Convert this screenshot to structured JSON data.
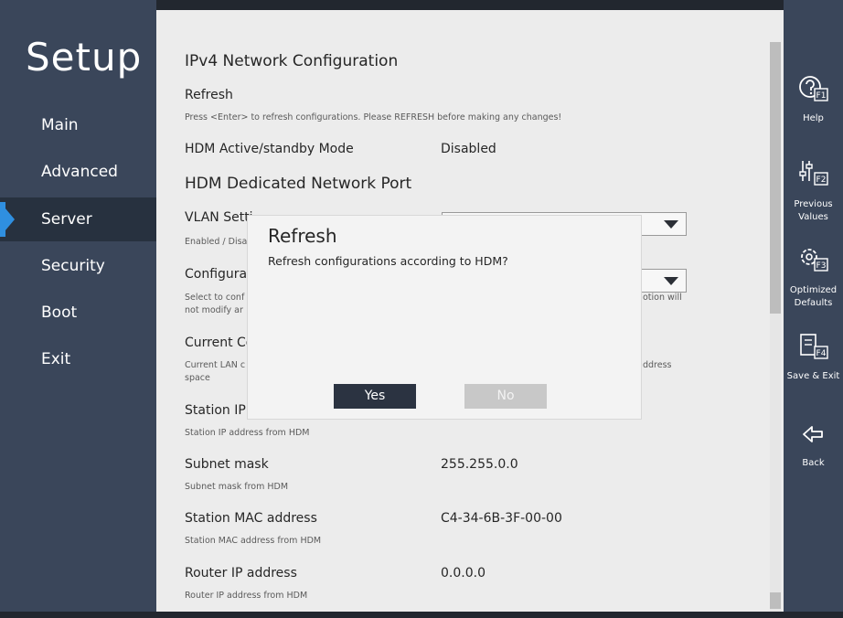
{
  "app": {
    "title": "Setup"
  },
  "nav": {
    "items": [
      {
        "label": "Main"
      },
      {
        "label": "Advanced"
      },
      {
        "label": "Server",
        "active": true
      },
      {
        "label": "Security"
      },
      {
        "label": "Boot"
      },
      {
        "label": "Exit"
      }
    ]
  },
  "content": {
    "section_title": "IPv4 Network Configuration",
    "refresh_label": "Refresh",
    "refresh_help": "Press <Enter> to refresh configurations. Please REFRESH before making any changes!",
    "hdm_mode_label": "HDM Active/standby Mode",
    "hdm_mode_value": "Disabled",
    "dedicated_port_title": "HDM Dedicated Network Port",
    "vlan_label": "VLAN Setti",
    "vlan_help": "Enabled / Disa",
    "config_label": "Configura",
    "config_help_1": "Select to conf",
    "config_help_1_right": "otion will",
    "config_help_2": "not modify ar",
    "current_label": "Current Co",
    "current_help_1": "Current LAN c",
    "current_help_1_right": "ddress",
    "current_help_2": "space",
    "station_ip_label": "Station IP",
    "station_ip_help": "Station IP address from HDM",
    "subnet_label": "Subnet mask",
    "subnet_value": "255.255.0.0",
    "subnet_help": "Subnet mask from HDM",
    "mac_label": "Station MAC address",
    "mac_value": "C4-34-6B-3F-00-00",
    "mac_help": "Station MAC address from HDM",
    "router_label": "Router IP address",
    "router_value": "0.0.0.0",
    "router_help": "Router IP address from HDM"
  },
  "dialog": {
    "title": "Refresh",
    "message": "Refresh configurations according to HDM?",
    "yes_label": "Yes",
    "no_label": "No"
  },
  "function_keys": [
    {
      "icon": "help-f1-icon",
      "key": "F1",
      "label": "Help"
    },
    {
      "icon": "previous-values-f2-icon",
      "key": "F2",
      "label_1": "Previous",
      "label_2": "Values"
    },
    {
      "icon": "optimized-defaults-f3-icon",
      "key": "F3",
      "label_1": "Optimized",
      "label_2": "Defaults"
    },
    {
      "icon": "save-exit-f4-icon",
      "key": "F4",
      "label": "Save & Exit"
    },
    {
      "icon": "back-arrow-icon",
      "label": "Back"
    }
  ],
  "colors": {
    "sidebar": "#3a465a",
    "active_nav": "#27313f",
    "accent": "#2f8fe0",
    "content_bg": "#ececec"
  }
}
